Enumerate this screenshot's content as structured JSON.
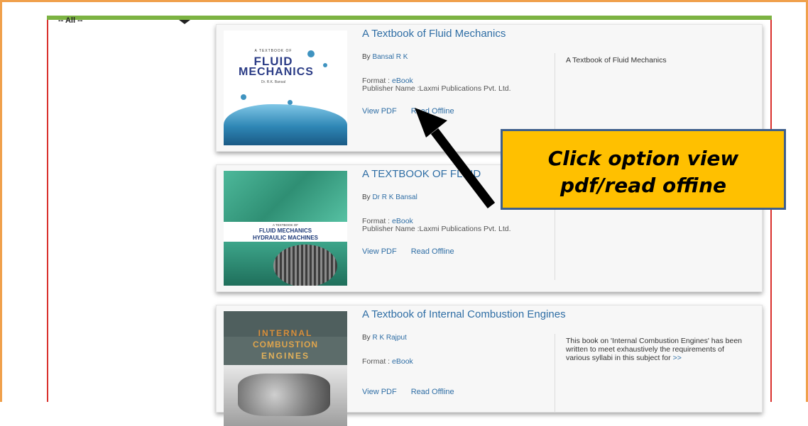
{
  "filter": {
    "selected": "-- All --"
  },
  "books": [
    {
      "title": "A Textbook of Fluid Mechanics",
      "by_label": "By",
      "author": "Bansal R K",
      "format_label": "Format :",
      "format": "eBook",
      "publisher": "Publisher Name :Laxmi Publications Pvt. Ltd.",
      "view_pdf": "View PDF",
      "read_offline": "Read Offline",
      "description": "A Textbook of Fluid Mechanics",
      "cover": {
        "small": "A TEXTBOOK OF",
        "line1": "FLUID",
        "line2": "MECHANICS",
        "author": "Dr. R.K. Bansal"
      }
    },
    {
      "title": "A TEXTBOOK OF FLUID",
      "by_label": "By",
      "author": "Dr R K Bansal",
      "format_label": "Format :",
      "format": "eBook",
      "publisher": "Publisher Name :Laxmi Publications Pvt. Ltd.",
      "view_pdf": "View PDF",
      "read_offline": "Read Offline",
      "description": "",
      "cover": {
        "small": "A TEXTBOOK OF",
        "line1": "FLUID MECHANICS",
        "line2": "HYDRAULIC MACHINES"
      }
    },
    {
      "title": "A Textbook of Internal Combustion Engines",
      "by_label": "By",
      "author": "R K Rajput",
      "format_label": "Format :",
      "format": "eBook",
      "publisher": "",
      "view_pdf": "View PDF",
      "read_offline": "Read Offline",
      "description": "This book on 'Internal Combustion Engines' has been written to meet exhaustively the requirements of various syllabi in this subject for",
      "more": ">>",
      "cover": {
        "line1": "INTERNAL",
        "line2": "COMBUSTION",
        "line3": "ENGINES"
      }
    }
  ],
  "callout": {
    "line1": "Click option view",
    "line2": "pdf/read offine"
  },
  "colors": {
    "callout_bg": "#ffc000",
    "callout_border": "#3f5f8c",
    "link": "#2f6ea5",
    "frame": "#f0a04b",
    "inner_frame": "#d9302c",
    "accent_bar": "#7cb342"
  }
}
